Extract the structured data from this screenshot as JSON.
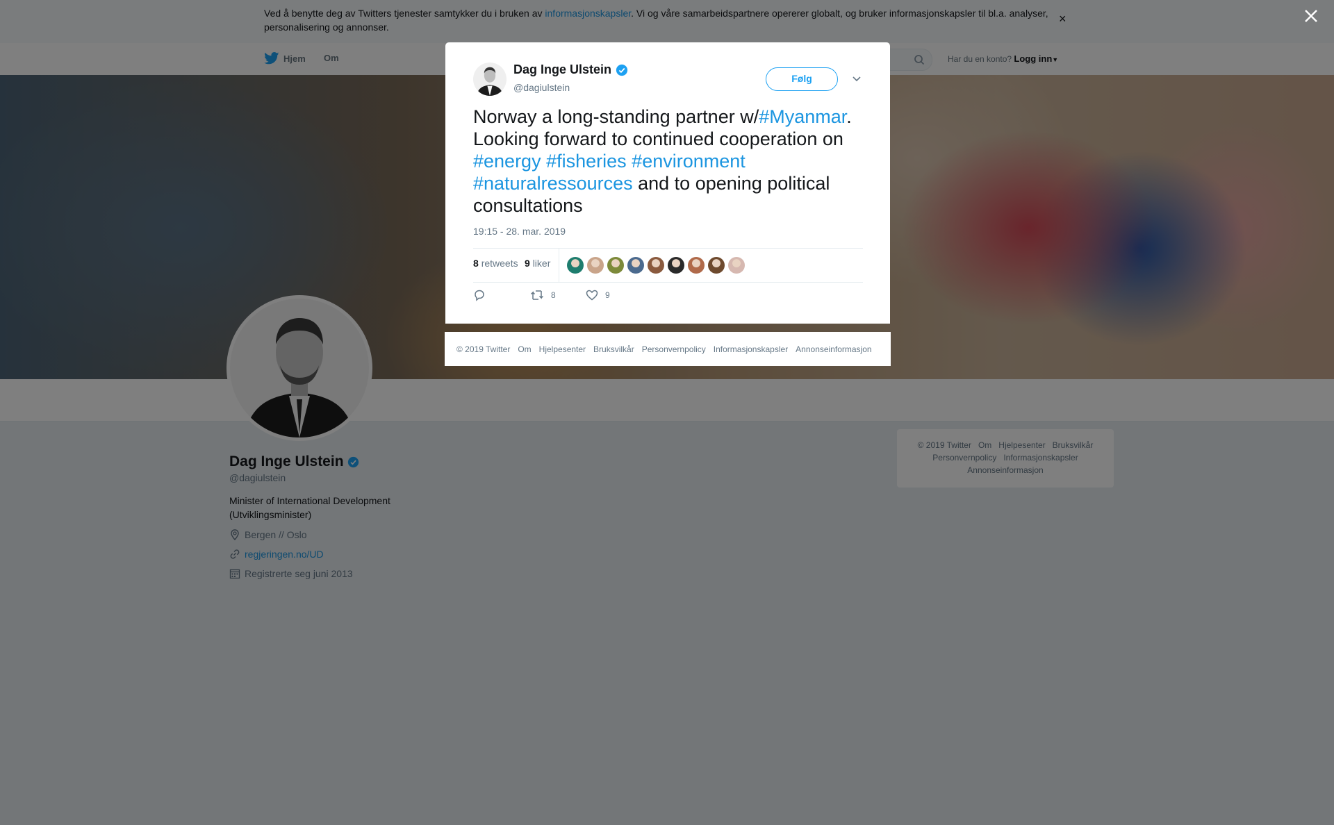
{
  "cookie_bar": {
    "text_before": "Ved å benytte deg av Twitters tjenester samtykker du i bruken av ",
    "link": "informasjonskapsler",
    "text_after": ". Vi og våre samarbeidspartnere opererer globalt, og bruker informasjonskapsler til bl.a. analyser, personalisering og annonser.",
    "close": "×"
  },
  "nav": {
    "home": "Hjem",
    "about": "Om",
    "account_prompt": "Har du en konto?",
    "login": "Logg inn"
  },
  "profile": {
    "name": "Dag Inge Ulstein",
    "handle": "@dagiulstein",
    "bio": "Minister of International Development (Utviklingsminister)",
    "location": "Bergen // Oslo",
    "url": "regjeringen.no/UD",
    "joined": "Registrerte seg juni 2013"
  },
  "side_footer": {
    "line1": [
      "© 2019 Twitter",
      "Om",
      "Hjelpesenter",
      "Bruksvilkår"
    ],
    "line2": [
      "Personvernpolicy",
      "Informasjonskapsler"
    ],
    "line3": [
      "Annonseinformasjon"
    ]
  },
  "tweet": {
    "name": "Dag Inge Ulstein",
    "handle": "@dagiulstein",
    "follow": "Følg",
    "text": {
      "p1": "Norway a long-standing partner w/",
      "tag_myanmar": "#Myanmar",
      "p2": ". Looking forward to continued cooperation on ",
      "tag_energy": "#energy",
      "tag_fisheries": "#fisheries",
      "tag_environment": "#environment",
      "tag_natural": "#naturalressources",
      "p3": " and to opening political consultations"
    },
    "timestamp": "19:15 - 28. mar. 2019",
    "retweets_count": "8",
    "retweets_label": "retweets",
    "likes_count": "9",
    "likes_label": "liker",
    "action_retweet_count": "8",
    "action_like_count": "9",
    "liker_avatar_colors": [
      "#1e7d6e",
      "#c9a48a",
      "#7d8a3a",
      "#4b6a8e",
      "#8a5a3e",
      "#2a2a2a",
      "#b06a4a",
      "#6e4a2e",
      "#d6b8b0"
    ]
  },
  "modal_footer": [
    "© 2019 Twitter",
    "Om",
    "Hjelpesenter",
    "Bruksvilkår",
    "Personvernpolicy",
    "Informasjonskapsler",
    "Annonseinformasjon"
  ],
  "colors": {
    "accent": "#1da1f2",
    "link": "#1b95e0",
    "verified": "#1da1f2"
  }
}
